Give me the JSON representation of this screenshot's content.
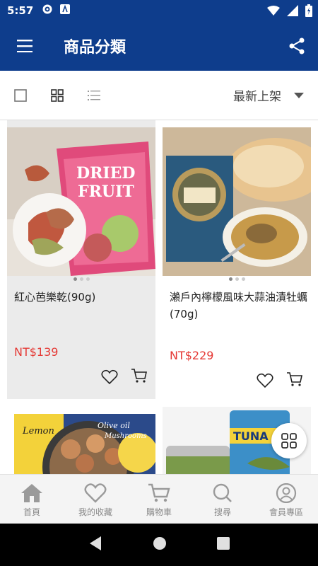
{
  "status_bar": {
    "time": "5:57"
  },
  "app_bar": {
    "title": "商品分類"
  },
  "toolbar": {
    "sort_label": "最新上架"
  },
  "products": [
    {
      "name": "紅心芭樂乾(90g)",
      "price": "NT$139"
    },
    {
      "name": "瀨戶內檸檬風味大蒜油漬牡蠣 (70g)",
      "price": "NT$229"
    }
  ],
  "bottom_nav": [
    {
      "label": "首頁",
      "icon": "home-icon"
    },
    {
      "label": "我的收藏",
      "icon": "heart-icon"
    },
    {
      "label": "購物車",
      "icon": "cart-icon"
    },
    {
      "label": "搜尋",
      "icon": "search-icon"
    },
    {
      "label": "會員專區",
      "icon": "user-icon"
    }
  ],
  "colors": {
    "brand": "#0e3d8c",
    "price": "#e53935"
  }
}
